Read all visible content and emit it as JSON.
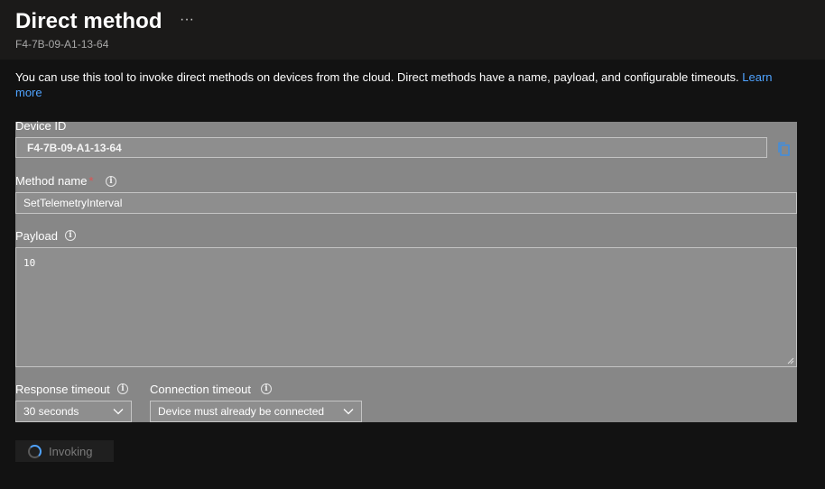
{
  "header": {
    "title": "Direct method",
    "more_label": "···",
    "subtitle": "F4-7B-09-A1-13-64"
  },
  "description": {
    "text": "You can use this tool to invoke direct methods on devices from the cloud. Direct methods have a name, payload, and configurable timeouts. ",
    "link_text": "Learn more"
  },
  "form": {
    "device_id": {
      "label": "Device ID",
      "value": "F4-7B-09-A1-13-64",
      "copy_icon": "copy-icon"
    },
    "method_name": {
      "label": "Method name",
      "required_marker": "*",
      "value": "SetTelemetryInterval"
    },
    "payload": {
      "label": "Payload",
      "value": "10"
    },
    "response_timeout": {
      "label": "Response timeout",
      "selected": "30 seconds"
    },
    "connection_timeout": {
      "label": "Connection timeout",
      "selected": "Device must already be connected"
    },
    "info_icon_glyph": "i"
  },
  "invoke": {
    "label": "Invoking",
    "state": "busy"
  },
  "colors": {
    "accent": "#4fa3ff",
    "required": "#e05252",
    "overlay": "#878787",
    "background": "#121212"
  }
}
